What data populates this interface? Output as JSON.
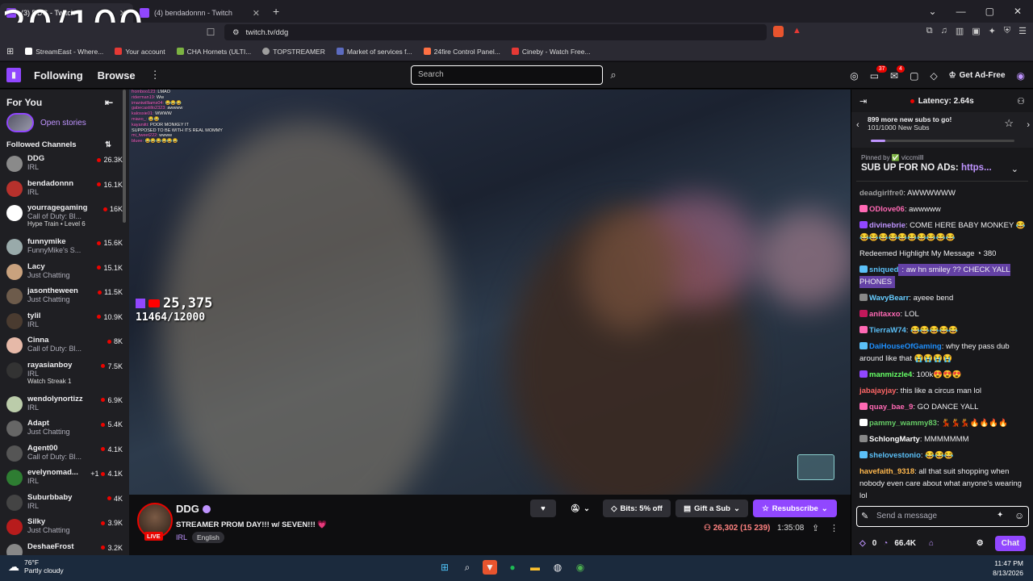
{
  "overlay_counter": "20/100",
  "tabs": [
    {
      "label": "(3) DDG - Twitch",
      "active": true
    },
    {
      "label": "(4) bendadonnn - Twitch",
      "active": false
    }
  ],
  "address": {
    "url": "twitch.tv/ddg"
  },
  "bookmarks": [
    {
      "label": "StreamEast - Where...",
      "color": "#ffffff"
    },
    {
      "label": "Your account",
      "color": "#e53935"
    },
    {
      "label": "CHA Hornets (ULTI...",
      "color": "#7cb342"
    },
    {
      "label": "TOPSTREAMER",
      "color": "#9e9e9e"
    },
    {
      "label": "Market of services f...",
      "color": "#5c6bc0"
    },
    {
      "label": "24fire Control Panel...",
      "color": "#ff7043"
    },
    {
      "label": "Cineby - Watch Free...",
      "color": "#e53935"
    }
  ],
  "nav": {
    "following": "Following",
    "browse": "Browse",
    "search_placeholder": "Search",
    "notif_count": "37",
    "inbox_count": "4",
    "ad_free": "Get Ad-Free"
  },
  "sidebar": {
    "for_you": "For You",
    "open_stories": "Open stories",
    "followed_channels": "Followed Channels",
    "channels": [
      {
        "name": "DDG",
        "category": "IRL",
        "viewers": "26.3K",
        "extra": "",
        "color": "#8a8a8a"
      },
      {
        "name": "bendadonnn",
        "category": "IRL",
        "viewers": "16.1K",
        "extra": "",
        "color": "#b7312c"
      },
      {
        "name": "yourragegaming",
        "category": "Call of Duty: Bl...",
        "viewers": "16K",
        "extra": "Hype Train • Level 6",
        "color": "#ffffff"
      },
      {
        "name": "funnymike",
        "category": "FunnyMike's S...",
        "viewers": "15.6K",
        "extra": "",
        "color": "#9aa"
      },
      {
        "name": "Lacy",
        "category": "Just Chatting",
        "viewers": "15.1K",
        "extra": "",
        "color": "#c9a27e"
      },
      {
        "name": "jasontheween",
        "category": "Just Chatting",
        "viewers": "11.5K",
        "extra": "",
        "color": "#6d5b4b"
      },
      {
        "name": "tylil",
        "category": "IRL",
        "viewers": "10.9K",
        "extra": "",
        "color": "#4a3b30"
      },
      {
        "name": "Cinna",
        "category": "Call of Duty: Bl...",
        "viewers": "8K",
        "extra": "",
        "color": "#e6b9a8"
      },
      {
        "name": "rayasianboy",
        "category": "IRL",
        "viewers": "7.5K",
        "extra": "Watch Streak 1",
        "color": "#333"
      },
      {
        "name": "wendolynortizz",
        "category": "IRL",
        "viewers": "6.9K",
        "extra": "",
        "color": "#bca"
      },
      {
        "name": "Adapt",
        "category": "Just Chatting",
        "viewers": "5.4K",
        "extra": "",
        "color": "#666"
      },
      {
        "name": "Agent00",
        "category": "Call of Duty: Bl...",
        "viewers": "4.1K",
        "extra": "",
        "color": "#555"
      },
      {
        "name": "evelynomad...",
        "category": "IRL",
        "viewers": "4.1K",
        "extra": "",
        "plus": "+1",
        "color": "#2e7d32"
      },
      {
        "name": "Suburbbaby",
        "category": "IRL",
        "viewers": "4K",
        "extra": "",
        "color": "#444"
      },
      {
        "name": "Silky",
        "category": "Just Chatting",
        "viewers": "3.9K",
        "extra": "",
        "color": "#b71c1c"
      },
      {
        "name": "DeshaeFrost",
        "category": "",
        "viewers": "3.2K",
        "extra": "",
        "color": "#888"
      }
    ]
  },
  "video": {
    "viewers_big": "25,375",
    "viewers_goal": "11464/12000",
    "overlay_chat": [
      {
        "user": "fromboo123:",
        "text": "LMAO"
      },
      {
        "user": "riderman19:",
        "text": "Ww"
      },
      {
        "user": "imaniwilliams04:",
        "text": "😂😂😂"
      },
      {
        "user": "gabecastillo2323:",
        "text": "awwww"
      },
      {
        "user": "kalossie01:",
        "text": "WWWW"
      },
      {
        "user": "miaxo_:",
        "text": "😂😂"
      },
      {
        "user": "kayaniiti:",
        "text": "POOR MONKEY IT"
      },
      {
        "user": "",
        "text": "SUPPOSED TO BE WITH ITS REAL MOMMY"
      },
      {
        "user": "mi_tweet222:",
        "text": "wwww"
      },
      {
        "user": "bluee:",
        "text": "😂😂😂😂😂😂"
      }
    ]
  },
  "stream": {
    "name": "DDG",
    "title": "STREAMER PROM DAY!!! w/ SEVEN!!! 💗",
    "category": "IRL",
    "tag": "English",
    "live": "LIVE",
    "bits": "Bits: 5% off",
    "gift": "Gift a Sub",
    "resub": "Resubscribe",
    "viewers": "26,302 (15 239)",
    "uptime": "1:35:08"
  },
  "chat": {
    "latency": "Latency: 2.64s",
    "subgoal_line1": "899 more new subs to go!",
    "subgoal_line2": "101/1000 New Subs",
    "subgoal_progress": 0.101,
    "pinned_by": "Pinned by ✅ viccmilll",
    "pinned_text": "SUB UP FOR NO ADs: ",
    "pinned_link": "https...",
    "messages": [
      {
        "user": "deadgirlfre0",
        "color": "#9e9e9e",
        "text": ": AWWWWWW",
        "badge": ""
      },
      {
        "user": "ODlove06",
        "color": "#ff69b4",
        "text": ": awwwww",
        "badge": "#ff69b4"
      },
      {
        "user": "divinebrie",
        "color": "#bf94ff",
        "text": ": COME HERE BABY MONKEY 😂😂😂😂😂😂😂😂😂😂😂",
        "badge": "#9147ff"
      },
      {
        "user": "",
        "color": "#fff",
        "text": "Redeemed Highlight My Message ◔ 380",
        "badge": ""
      },
      {
        "user": "sniqued",
        "color": "#5bc0f8",
        "text": ": aw hn smiley ?? CHECK YALL PHONES",
        "badge": "#5bc0f8",
        "highlight": true
      },
      {
        "user": "WavyBearr",
        "color": "#66ccff",
        "text": ": ayeee bend",
        "badge": "#888"
      },
      {
        "user": "anitaxxo",
        "color": "#ff69b4",
        "text": ": LOL",
        "badge": "#c2185b"
      },
      {
        "user": "TierraW74",
        "color": "#5bc0f8",
        "text": ": 😂😂😂😂😂",
        "badge": "#ff69b4"
      },
      {
        "user": "DaiHouseOfGaming",
        "color": "#1e90ff",
        "text": ": why they pass dub around like that 😭😭😭😭",
        "badge": "#5bc0f8"
      },
      {
        "user": "manmizzle4",
        "color": "#66ff66",
        "text": ": 100k😍😍😍",
        "badge": "#9147ff"
      },
      {
        "user": "jabajayjay",
        "color": "#ff6666",
        "text": ": this like a circus man lol",
        "badge": ""
      },
      {
        "user": "quay_bae_9",
        "color": "#ff69b4",
        "text": ": GO DANCE YALL",
        "badge": "#ff69b4"
      },
      {
        "user": "pammy_wammy83",
        "color": "#66cc66",
        "text": ": 💃💃💃🔥🔥🔥🔥",
        "badge": "#fff"
      },
      {
        "user": "SchlongMarty",
        "color": "#fff",
        "text": ": MMMMMMM",
        "badge": "#888"
      },
      {
        "user": "shelovestonio",
        "color": "#5bc0f8",
        "text": ": 😂😂😂",
        "badge": "#5bc0f8"
      },
      {
        "user": "havefaith_9318",
        "color": "#ffb84d",
        "text": ": all that suit shopping when nobody even care about what anyone's wearing lol",
        "badge": ""
      }
    ],
    "input_placeholder": "Send a message",
    "points_left": "0",
    "points": "66.4K",
    "chat_button": "Chat"
  },
  "taskbar": {
    "temp": "76°F",
    "weather": "Partly cloudy",
    "time": "11:47 PM",
    "date": "8/13/2026"
  }
}
